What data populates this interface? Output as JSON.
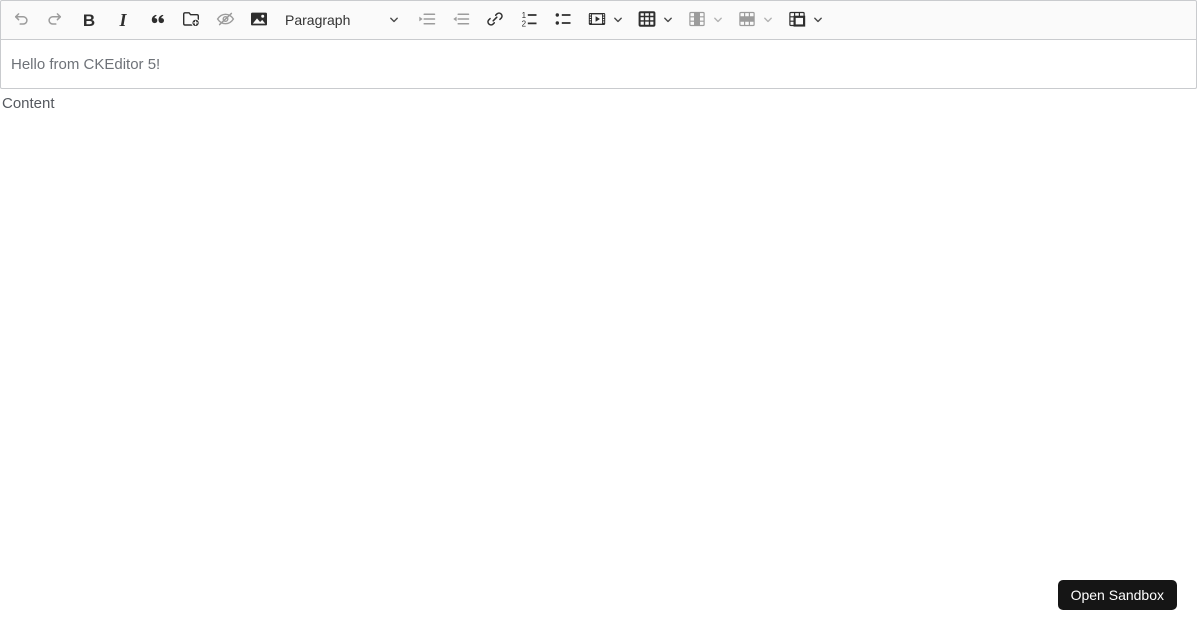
{
  "toolbar": {
    "paragraph_label": "Paragraph",
    "bold_glyph": "B",
    "italic_glyph": "I",
    "items": [
      {
        "icon": "undo",
        "enabled": false
      },
      {
        "icon": "redo",
        "enabled": false
      },
      {
        "icon": "bold",
        "enabled": true
      },
      {
        "icon": "italic",
        "enabled": true
      },
      {
        "icon": "block-quote",
        "enabled": true
      },
      {
        "icon": "insert-file",
        "enabled": true
      },
      {
        "icon": "restricted-editing",
        "enabled": false
      },
      {
        "icon": "insert-image",
        "enabled": true
      },
      {
        "icon": "paragraph-dropdown",
        "label": "Paragraph",
        "enabled": true
      },
      {
        "icon": "indent",
        "enabled": false
      },
      {
        "icon": "outdent",
        "enabled": false
      },
      {
        "icon": "link",
        "enabled": true
      },
      {
        "icon": "numbered-list",
        "enabled": true
      },
      {
        "icon": "bulleted-list",
        "enabled": true
      },
      {
        "icon": "media-embed",
        "enabled": true,
        "dropdown": true
      },
      {
        "icon": "insert-table",
        "enabled": true,
        "dropdown": true
      },
      {
        "icon": "table-column",
        "enabled": false,
        "dropdown": true
      },
      {
        "icon": "table-row",
        "enabled": false,
        "dropdown": true
      },
      {
        "icon": "merge-cells",
        "enabled": true,
        "dropdown": true
      }
    ]
  },
  "editor": {
    "content_text": "Hello from CKEditor 5!"
  },
  "page": {
    "content_label": "Content",
    "open_sandbox_label": "Open Sandbox"
  },
  "colors": {
    "toolbar_bg": "#fafafa",
    "border": "#c9cbce",
    "icon": "#2e2e2e",
    "icon_disabled": "#9c9c9c",
    "editor_text": "#6e7278",
    "sandbox_bg": "#151515",
    "sandbox_text": "#ffffff"
  }
}
